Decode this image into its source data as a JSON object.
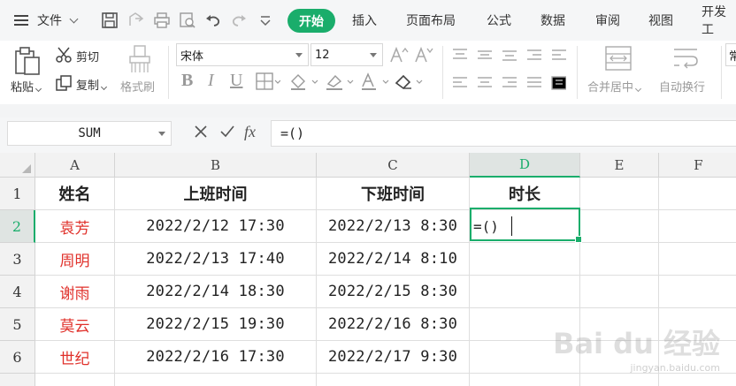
{
  "menubar": {
    "file_label": "文件",
    "tabs": [
      "开始",
      "插入",
      "页面布局",
      "公式",
      "数据",
      "审阅",
      "视图",
      "开发工"
    ],
    "active_tab": "开始",
    "accent": "#1aad6b"
  },
  "ribbon": {
    "paste_label": "粘贴",
    "cut_label": "剪切",
    "copy_label": "复制",
    "format_painter_label": "格式刷",
    "font_name": "宋体",
    "font_size": "12",
    "merge_label": "合并居中",
    "wrap_label": "自动换行",
    "cut_off_label": "常"
  },
  "formula_bar": {
    "name_box": "SUM",
    "fx": "fx",
    "formula": "=()"
  },
  "sheet": {
    "columns": [
      "A",
      "B",
      "C",
      "D",
      "E",
      "F"
    ],
    "active_column": "D",
    "rows": [
      "1",
      "2",
      "3",
      "4",
      "5",
      "6"
    ],
    "active_row": "2",
    "header": [
      "姓名",
      "上班时间",
      "下班时间",
      "时长"
    ],
    "data": [
      {
        "name": "袁芳",
        "start": "2022/2/12 17:30",
        "end": "2022/2/13 8:30",
        "duration": "=()"
      },
      {
        "name": "周明",
        "start": "2022/2/13 17:40",
        "end": "2022/2/14 8:10",
        "duration": ""
      },
      {
        "name": "谢雨",
        "start": "2022/2/14 18:30",
        "end": "2022/2/15 8:30",
        "duration": ""
      },
      {
        "name": "莫云",
        "start": "2022/2/15 19:30",
        "end": "2022/2/16 8:30",
        "duration": ""
      },
      {
        "name": "世纪",
        "start": "2022/2/16 17:30",
        "end": "2022/2/17 9:30",
        "duration": ""
      }
    ],
    "name_color": "#e0302a"
  },
  "watermark": {
    "brand": "Bai du 经验",
    "url": "jingyan.baidu.com"
  }
}
